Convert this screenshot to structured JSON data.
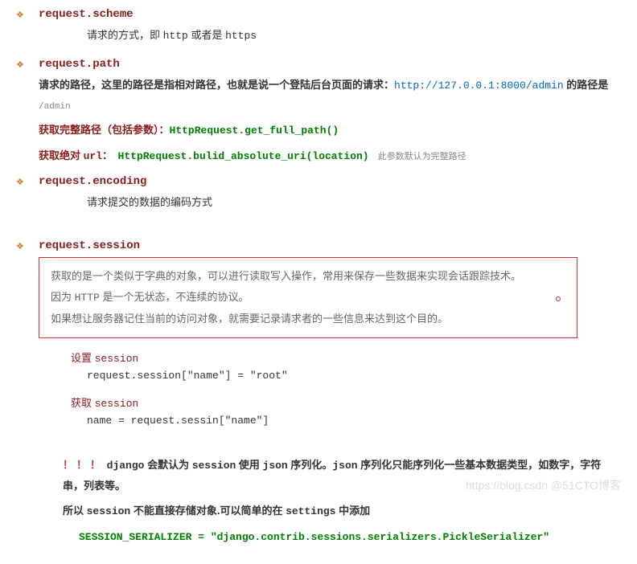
{
  "s1": {
    "title": "request.scheme",
    "desc_pre": "请求的方式，即 ",
    "desc_code1": "http",
    "desc_mid": " 或者是 ",
    "desc_code2": "https"
  },
  "s2": {
    "title": "request.path",
    "l1_pre": "请求的路径，这里的路径是指相对路径，也就是说一个登陆后台页面的请求：",
    "l1_url": "http://127.0.0.1:8000/admin",
    "l1_post": " 的路径是 ",
    "l1_code": "/admin",
    "l2_label": "获取完整路径（包括参数）",
    "l2_sep": "：",
    "l2_code": "HttpRequest.get_full_path()",
    "l3_label": "获取绝对 ",
    "l3_url_word": "url",
    "l3_sep": "：　",
    "l3_code": "HttpRequest.bulid_absolute_uri(location)",
    "l3_note": "　此参数默认为完整路径"
  },
  "s3": {
    "title": "request.encoding",
    "desc": "请求提交的数据的编码方式"
  },
  "s4": {
    "title": "request.session",
    "box_l1": "获取的是一个类似于字典的对象，可以进行读取写入操作，常用来保存一些数据来实现会话跟踪技术。",
    "box_l2_pre": "因为 ",
    "box_l2_code": "HTTP",
    "box_l2_post": " 是一个无状态，不连续的协议。",
    "box_l3": "如果想让服务器记住当前的访问对象，就需要记录请求者的一些信息来达到这个目的。",
    "set_title_pre": "设置 ",
    "set_title_code": "session",
    "set_code": "request.session[\"name\"] = \"root\"",
    "get_title_pre": "获取 ",
    "get_title_code": "session",
    "get_code": "name = request.sessin[\"name\"]",
    "warn_excl": "！！！",
    "warn_p1": "django",
    "warn_p2": " 会默认为 ",
    "warn_p3": "session",
    "warn_p4": " 使用 ",
    "warn_p5": "json",
    "warn_p6": " 序列化。",
    "warn_p7": "json",
    "warn_p8": " 序列化只能序列化一些基本数据类型，如数字，字符串，列表等。",
    "warn2_p1": "所以 ",
    "warn2_p2": "session",
    "warn2_p3": " 不能直接存储对象.可以简单的在 ",
    "warn2_p4": "settings",
    "warn2_p5": " 中添加",
    "serializer": "SESSION_SERIALIZER = \"django.contrib.sessions.serializers.PickleSerializer\""
  },
  "watermark": "https://blog.csdn  @51CTO博客"
}
